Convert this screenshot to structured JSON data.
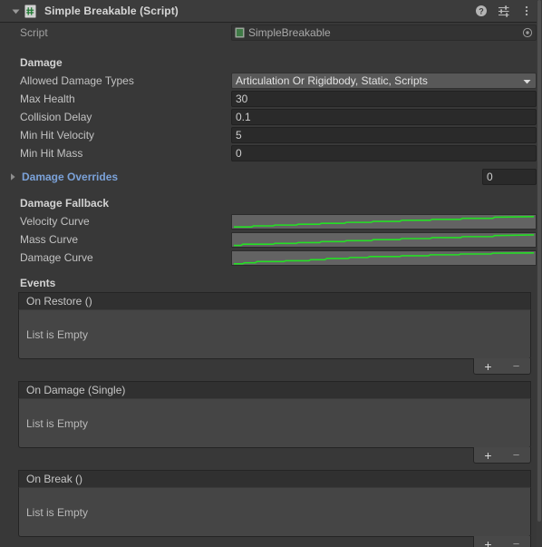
{
  "component": {
    "title": "Simple Breakable (Script)",
    "icon": "csharp-script-icon",
    "expanded": true,
    "header_icons": [
      "help-icon",
      "preset-icon",
      "more-menu-icon"
    ]
  },
  "script_row": {
    "label": "Script",
    "value": "SimpleBreakable",
    "picker_icon": "object-picker-icon"
  },
  "damage": {
    "header": "Damage",
    "fields": [
      {
        "label": "Allowed Damage Types",
        "value": "Articulation Or Rigidbody, Static, Scripts",
        "type": "dropdown"
      },
      {
        "label": "Max Health",
        "value": "30",
        "type": "number"
      },
      {
        "label": "Collision Delay",
        "value": "0.1",
        "type": "number"
      },
      {
        "label": "Min Hit Velocity",
        "value": "5",
        "type": "number"
      },
      {
        "label": "Min Hit Mass",
        "value": "0",
        "type": "number"
      }
    ]
  },
  "damage_overrides": {
    "label": "Damage Overrides",
    "expanded": false,
    "size": "0"
  },
  "damage_fallback": {
    "header": "Damage Fallback",
    "curves": [
      {
        "label": "Velocity Curve",
        "color": "#24e024"
      },
      {
        "label": "Mass Curve",
        "color": "#24e024"
      },
      {
        "label": "Damage Curve",
        "color": "#24e024"
      }
    ]
  },
  "events": {
    "header": "Events",
    "list": [
      {
        "title": "On Restore ()",
        "empty_text": "List is Empty",
        "add_label": "+",
        "remove_label": "−"
      },
      {
        "title": "On Damage (Single)",
        "empty_text": "List is Empty",
        "add_label": "+",
        "remove_label": "−"
      },
      {
        "title": "On Break ()",
        "empty_text": "List is Empty",
        "add_label": "+",
        "remove_label": "−"
      }
    ]
  },
  "colors": {
    "panel_bg": "#383838",
    "header_bg": "#3c3c3c",
    "field_bg": "#2a2a2a",
    "dropdown_bg": "#585858",
    "curve_line": "#24e024",
    "foldout_link": "#7ba2d9",
    "event_body_bg": "#454545"
  }
}
